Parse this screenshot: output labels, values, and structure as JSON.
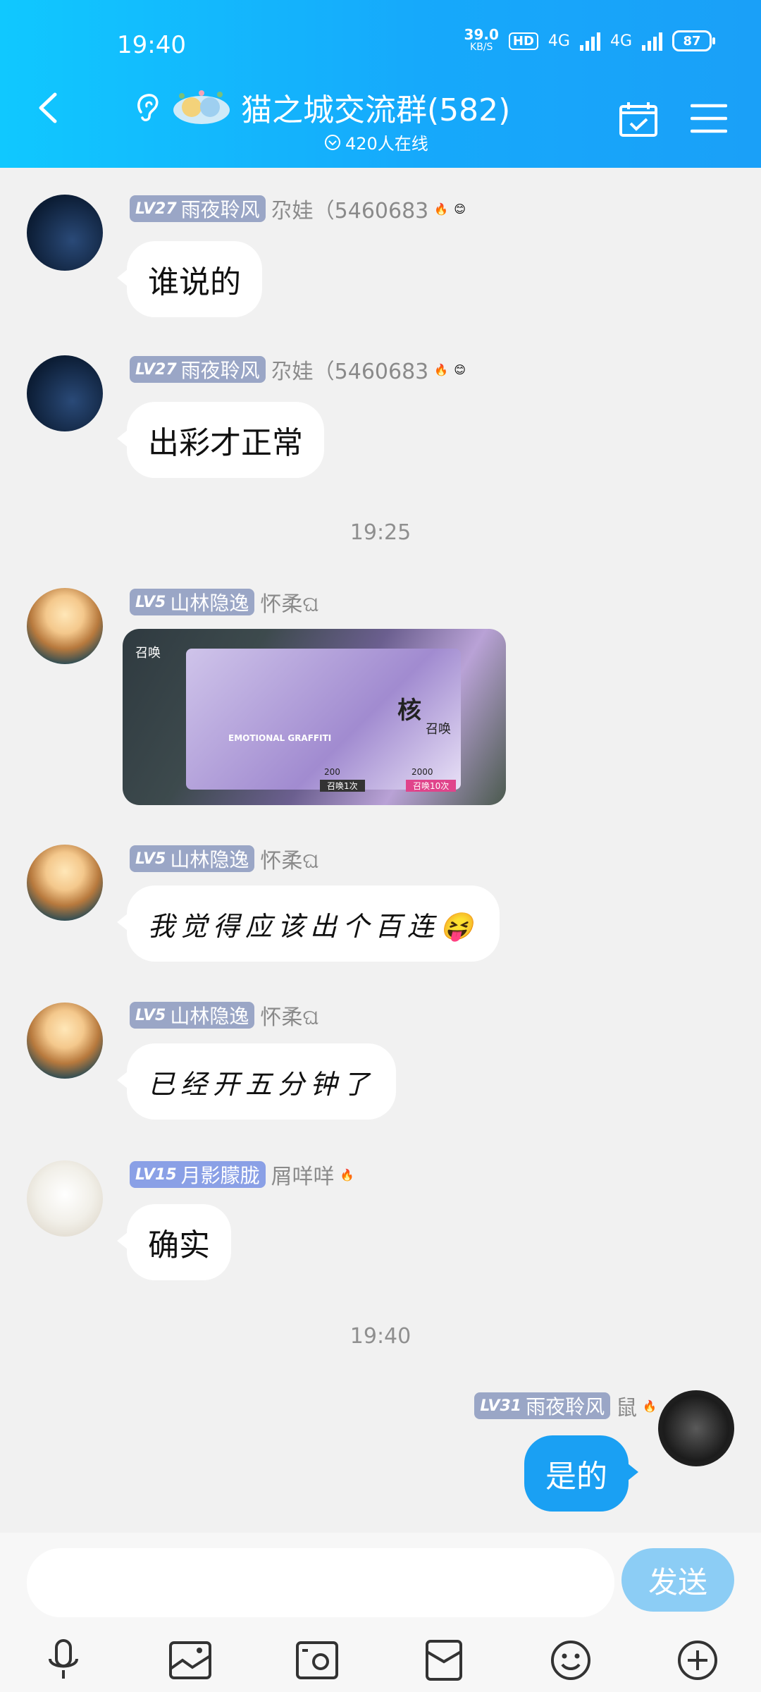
{
  "status_bar": {
    "time": "19:40",
    "net_speed": "39.0",
    "net_unit": "KB/S",
    "hd": "HD",
    "net1": "4G",
    "net2": "4G",
    "battery": "87"
  },
  "header": {
    "title": "猫之城交流群(582)",
    "online": "420人在线"
  },
  "timestamps": [
    "19:25",
    "19:40"
  ],
  "messages": [
    {
      "level": "LV27",
      "title": "雨夜聆风",
      "nickname": "尕娃（5460683",
      "text": "谁说的"
    },
    {
      "level": "LV27",
      "title": "雨夜聆风",
      "nickname": "尕娃（5460683",
      "text": "出彩才正常"
    },
    {
      "level": "LV5",
      "title": "山林隐逸",
      "nickname": "怀柔ଘ",
      "image_texts": [
        "召唤",
        "EMOTIONAL GRAFFITI",
        "核",
        "召唤",
        "200",
        "2000",
        "召唤1次",
        "召唤10次"
      ]
    },
    {
      "level": "LV5",
      "title": "山林隐逸",
      "nickname": "怀柔ଘ",
      "text": "我觉得应该出个百连😝"
    },
    {
      "level": "LV5",
      "title": "山林隐逸",
      "nickname": "怀柔ଘ",
      "text": "已经开五分钟了"
    },
    {
      "level": "LV15",
      "title": "月影朦胧",
      "nickname": "屑咩咩",
      "text": "确实"
    },
    {
      "level": "LV31",
      "title": "雨夜聆风",
      "nickname": "鼠",
      "text": "是的"
    }
  ],
  "input": {
    "placeholder": "",
    "send_label": "发送"
  },
  "colors": {
    "header_start": "#10c8ff",
    "header_end": "#1aa0f8",
    "my_bubble": "#1aa0f3",
    "level_badge": "#9aa6c6"
  }
}
